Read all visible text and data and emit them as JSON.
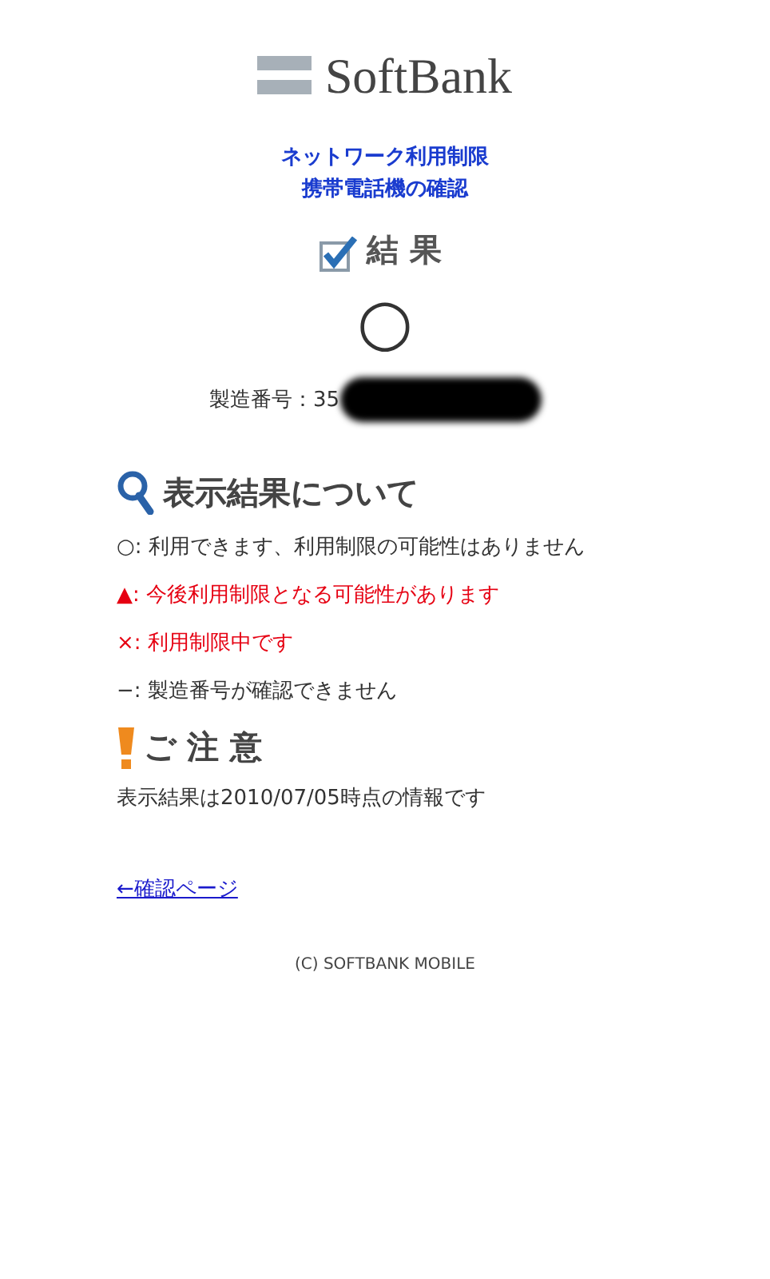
{
  "logo": {
    "text": "SoftBank"
  },
  "title_lines": [
    "ネットワーク利用制限",
    "携帯電話機の確認"
  ],
  "result_heading": "結 果",
  "result_symbol": "○",
  "serial": {
    "label": "製造番号：35"
  },
  "legend_heading": "表示結果について",
  "legend": [
    {
      "symbol": "○",
      "text": ": 利用できます、利用制限の可能性はありません",
      "color": "#333333"
    },
    {
      "symbol": "▲",
      "text": ": 今後利用制限となる可能性があります",
      "color": "#e60012"
    },
    {
      "symbol": "×",
      "text": ": 利用制限中です",
      "color": "#e60012"
    },
    {
      "symbol": "−",
      "text": ": 製造番号が確認できません",
      "color": "#333333"
    }
  ],
  "notice_heading": "ご 注 意",
  "notice_text": "表示結果は2010/07/05時点の情報です",
  "back_link": "←確認ページ",
  "footer": "(C) SOFTBANK MOBILE"
}
